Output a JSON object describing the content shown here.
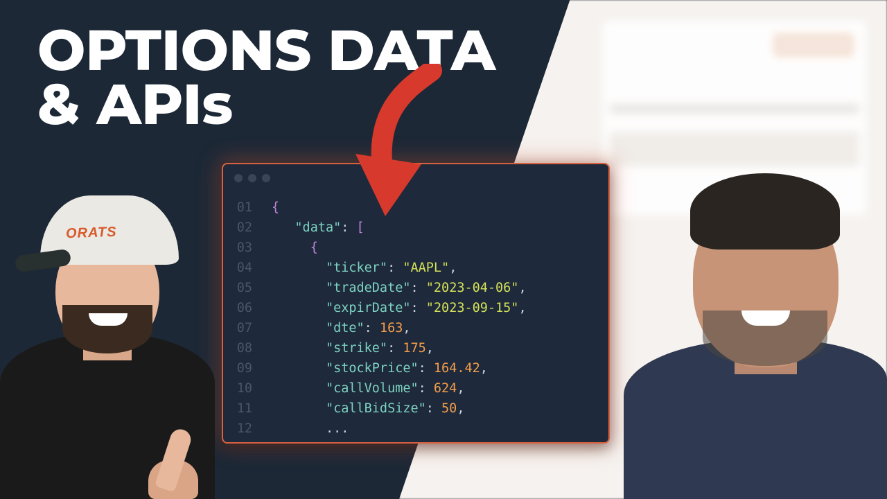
{
  "title": {
    "line1": "OPTIONS DATA",
    "line2": "& APIs"
  },
  "cap_text": "ORATS",
  "code": {
    "line_numbers": [
      "01",
      "02",
      "03",
      "04",
      "05",
      "06",
      "07",
      "08",
      "09",
      "10",
      "11",
      "12"
    ],
    "open_brace": "{",
    "data_key": "\"data\"",
    "open_bracket": "[",
    "inner_open": "{",
    "fields": [
      {
        "key": "\"ticker\"",
        "value": "\"AAPL\"",
        "type": "str"
      },
      {
        "key": "\"tradeDate\"",
        "value": "\"2023-04-06\"",
        "type": "str"
      },
      {
        "key": "\"expirDate\"",
        "value": "\"2023-09-15\"",
        "type": "str"
      },
      {
        "key": "\"dte\"",
        "value": "163",
        "type": "num"
      },
      {
        "key": "\"strike\"",
        "value": "175",
        "type": "num"
      },
      {
        "key": "\"stockPrice\"",
        "value": "164.42",
        "type": "num"
      },
      {
        "key": "\"callVolume\"",
        "value": "624",
        "type": "num"
      },
      {
        "key": "\"callBidSize\"",
        "value": "50",
        "type": "num"
      }
    ],
    "ellipsis": "..."
  }
}
